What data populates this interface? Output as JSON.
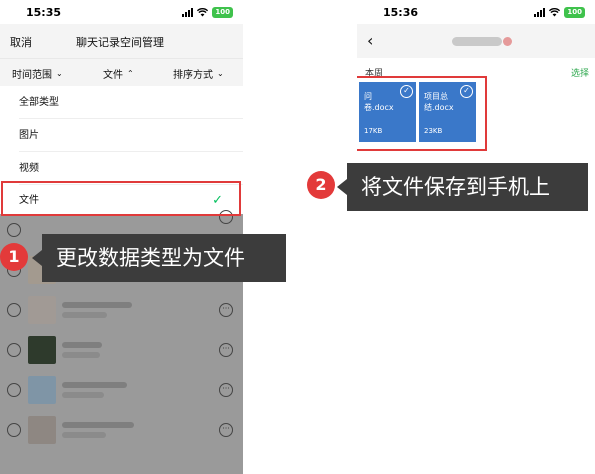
{
  "left_phone": {
    "status_time": "15:35",
    "battery": "100",
    "header": {
      "cancel": "取消",
      "title": "聊天记录空间管理"
    },
    "filters": [
      {
        "label": "时间范围"
      },
      {
        "label": "文件"
      },
      {
        "label": "排序方式"
      }
    ],
    "type_menu": {
      "items": [
        "全部类型",
        "图片",
        "视频",
        "文件"
      ],
      "selected": "文件"
    }
  },
  "right_phone": {
    "status_time": "15:36",
    "battery": "100",
    "section_label": "本周",
    "select_label": "选择",
    "files": [
      {
        "name": "问卷.docx",
        "size": "17KB"
      },
      {
        "name": "项目总结.docx",
        "size": "23KB"
      }
    ]
  },
  "callouts": [
    {
      "number": "1",
      "text": "更改数据类型为文件"
    },
    {
      "number": "2",
      "text": "将文件保存到手机上"
    }
  ],
  "colors": {
    "highlight": "#e03a3a",
    "callout_bg": "#3c3c3c",
    "file_card": "#3a78c9",
    "check_green": "#07c160",
    "select_green": "#2fa84f"
  },
  "icons": [
    "signal-icon",
    "wifi-icon",
    "back-icon",
    "check-icon",
    "chevron-down-icon",
    "chevron-up-icon",
    "more-icon",
    "radio-icon"
  ]
}
